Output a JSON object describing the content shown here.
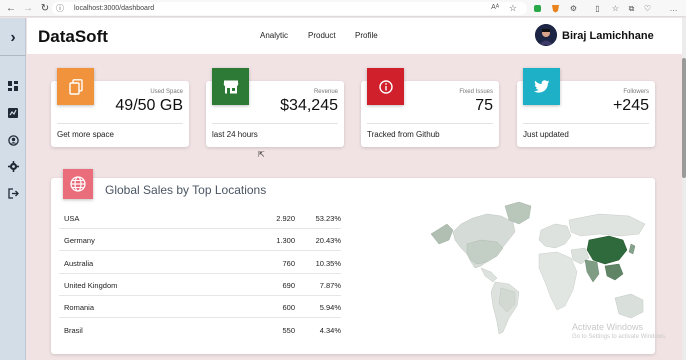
{
  "browser": {
    "url": "localhost:3000/dashboard",
    "reader_label": "Aᴬ"
  },
  "sidebar": {
    "toggle_glyph": "›",
    "icons": [
      "dashboard-icon",
      "chart-icon",
      "user-circle-icon",
      "settings-icon",
      "logout-icon"
    ]
  },
  "header": {
    "brand": "DataSoft",
    "nav": [
      "Analytic",
      "Product",
      "Profile"
    ],
    "user_name": "Biraj Lamichhane"
  },
  "cards": [
    {
      "label": "Used Space",
      "value": "49/50 GB",
      "footer": "Get more space",
      "color": "#f1923d",
      "icon": "copy-icon"
    },
    {
      "label": "Revenue",
      "value": "$34,245",
      "footer": "last 24 hours",
      "color": "#2c7a36",
      "icon": "store-icon"
    },
    {
      "label": "Fixed Issues",
      "value": "75",
      "footer": "Tracked from Github",
      "color": "#d0202c",
      "icon": "info-icon"
    },
    {
      "label": "Followers",
      "value": "+245",
      "footer": "Just updated",
      "color": "#1db0c7",
      "icon": "twitter-icon"
    }
  ],
  "sales": {
    "title": "Global Sales by Top Locations",
    "rows": [
      {
        "country": "USA",
        "value": "2.920",
        "percent": "53.23%"
      },
      {
        "country": "Germany",
        "value": "1.300",
        "percent": "20.43%"
      },
      {
        "country": "Australia",
        "value": "760",
        "percent": "10.35%"
      },
      {
        "country": "United Kingdom",
        "value": "690",
        "percent": "7.87%"
      },
      {
        "country": "Romania",
        "value": "600",
        "percent": "5.94%"
      },
      {
        "country": "Brasil",
        "value": "550",
        "percent": "4.34%"
      }
    ]
  },
  "watermark": {
    "line1": "Activate Windows",
    "line2": "Go to Settings to activate Windows."
  }
}
